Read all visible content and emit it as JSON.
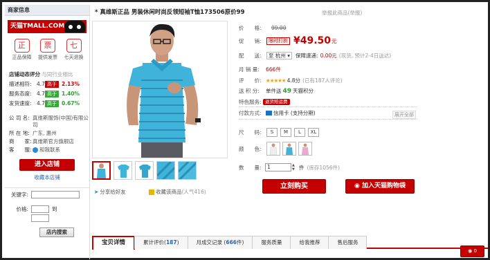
{
  "sidebar": {
    "header": "商家信息",
    "brand": "天猫TMALL.COM",
    "assurances": [
      {
        "icon": "正",
        "label": "正品保障"
      },
      {
        "icon": "票",
        "label": "提供发票"
      },
      {
        "icon": "七",
        "label": "七天退换"
      }
    ],
    "rating_title": "店铺动态评分",
    "rating_compare": "与同行业相比",
    "ratings": [
      {
        "label": "描述相符:",
        "score": "4.7",
        "badge": "高于",
        "pct": "2.13%"
      },
      {
        "label": "服务态度:",
        "score": "4.7",
        "badge": "高于",
        "pct": "1.40%"
      },
      {
        "label": "发货速度:",
        "score": "4.7",
        "badge": "高于",
        "pct": "0.67%"
      }
    ],
    "shop": {
      "company_label": "公 司 名:",
      "company": "真维斯服饰(中国)有限公司",
      "location_label": "所 在 地:",
      "location": "广东, 惠州",
      "merchant_label": "商　　家:",
      "merchant": "真维斯官方旗舰店",
      "service_label": "客　　服:",
      "service": "和我联系"
    },
    "enter_shop": "进入店铺",
    "fav_shop": "收藏本店铺",
    "search": {
      "keyword_label": "关键字:",
      "price_label": "价格:",
      "to": "到",
      "button": "店内搜索"
    }
  },
  "product": {
    "title": "* 真维斯正品 男装休闲时尚反领短袖T恤173506原价99",
    "report": "举报此商品(举报)",
    "share": "分享给好友",
    "collect": "收藏该商品",
    "collect_count": "(人气416)"
  },
  "info": {
    "price_label": "价　　格:",
    "orig_price": "99.00",
    "promo_label": "促　　销:",
    "promo_tag": "限时打折",
    "price": "¥49.50",
    "yuan": "元",
    "ship_label": "配　　送:",
    "ship_to": "至 杭州",
    "ship_text": "保障速递:",
    "ship_fee": "0.00元",
    "ship_note": "(现货, 预计2-4日送达)",
    "monthly_label": "月 销 量:",
    "monthly": "666件",
    "review_label": "评　　价:",
    "stars": "★★★★★",
    "review_score": "4.8分",
    "review_count": "(已有187人评论)",
    "points_label": "送 积 分:",
    "points_pre": "单件送",
    "points": "49",
    "points_post": "天猫积分",
    "special_label": "特色服务:",
    "special": "退货赔运费",
    "pay_label": "付款方式:",
    "pay": "信用卡 (支持分期)",
    "collapse": "展开全部",
    "size_label": "尺　　码:",
    "sizes": [
      "S",
      "M",
      "L",
      "XL"
    ],
    "color_label": "颜　　色:",
    "qty_label": "数　　量:",
    "qty": "1",
    "qty_unit": "件",
    "stock": "(库存1056件)",
    "buy_now": "立刻购买",
    "add_cart": "加入天猫购物袋"
  },
  "tabs": {
    "detail": "宝贝详情",
    "reviews": "累计评价(",
    "reviews_num": "187",
    "reviews_end": ")",
    "monthly": "月成交记录 (",
    "monthly_num": "666",
    "monthly_end": "件)",
    "service": "服务质量",
    "recommend": "给我推荐",
    "after": "售后服务"
  },
  "cart_float": "0"
}
